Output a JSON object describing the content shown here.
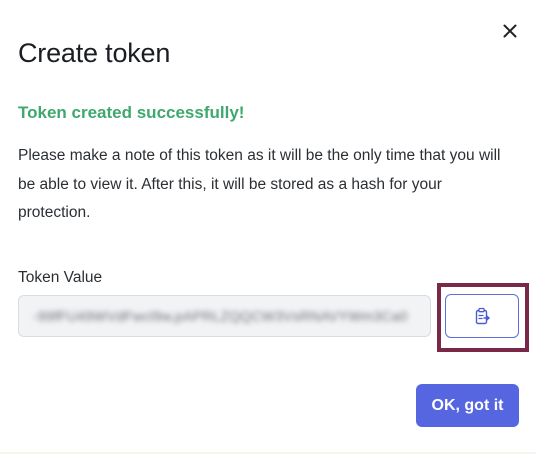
{
  "dialog": {
    "title": "Create token",
    "close_icon": "close-icon",
    "success_message": "Token created successfully!",
    "note": "Please make a note of this token as it will be the only time that you will be able to view it. After this, it will be stored as a hash for your protection.",
    "token_label": "Token Value",
    "token_value": "-99fFU49WVdFwcl9w,pAPRLZQQCW3VsRNAVYWm3Ca0",
    "copy_icon": "clipboard-copy-icon",
    "ok_label": "OK, got it"
  },
  "colors": {
    "success": "#3fa86e",
    "primary": "#5566e0",
    "highlight": "#7a2847"
  }
}
